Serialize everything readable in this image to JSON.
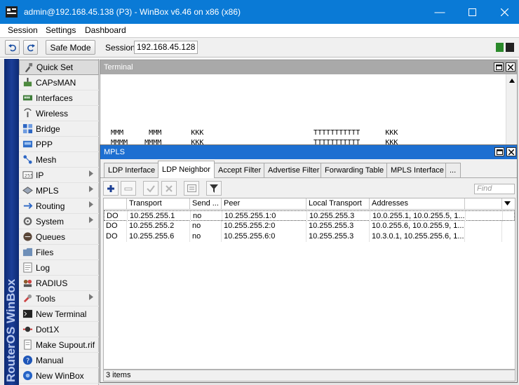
{
  "window": {
    "title": "admin@192.168.45.138 (P3) - WinBox v6.46 on x86 (x86)"
  },
  "menu": [
    "Session",
    "Settings",
    "Dashboard"
  ],
  "toolbar": {
    "safe_mode_label": "Safe Mode",
    "session_label": "Session:",
    "session_value": "192.168.45.128"
  },
  "brand_vertical": "RouterOS WinBox",
  "sidebar": {
    "items": [
      {
        "label": "Quick Set",
        "icon": "quick-set-icon",
        "arrow": false
      },
      {
        "label": "CAPsMAN",
        "icon": "capsman-icon",
        "arrow": false
      },
      {
        "label": "Interfaces",
        "icon": "interfaces-icon",
        "arrow": false
      },
      {
        "label": "Wireless",
        "icon": "wireless-icon",
        "arrow": false
      },
      {
        "label": "Bridge",
        "icon": "bridge-icon",
        "arrow": false
      },
      {
        "label": "PPP",
        "icon": "ppp-icon",
        "arrow": false
      },
      {
        "label": "Mesh",
        "icon": "mesh-icon",
        "arrow": false
      },
      {
        "label": "IP",
        "icon": "ip-icon",
        "arrow": true
      },
      {
        "label": "MPLS",
        "icon": "mpls-icon",
        "arrow": true
      },
      {
        "label": "Routing",
        "icon": "routing-icon",
        "arrow": true
      },
      {
        "label": "System",
        "icon": "system-icon",
        "arrow": true
      },
      {
        "label": "Queues",
        "icon": "queues-icon",
        "arrow": false
      },
      {
        "label": "Files",
        "icon": "files-icon",
        "arrow": false
      },
      {
        "label": "Log",
        "icon": "log-icon",
        "arrow": false
      },
      {
        "label": "RADIUS",
        "icon": "radius-icon",
        "arrow": false
      },
      {
        "label": "Tools",
        "icon": "tools-icon",
        "arrow": true
      },
      {
        "label": "New Terminal",
        "icon": "terminal-icon",
        "arrow": false
      },
      {
        "label": "Dot1X",
        "icon": "dot1x-icon",
        "arrow": false
      },
      {
        "label": "Make Supout.rif",
        "icon": "supout-icon",
        "arrow": false
      },
      {
        "label": "Manual",
        "icon": "manual-icon",
        "arrow": false
      },
      {
        "label": "New WinBox",
        "icon": "winbox-icon",
        "arrow": false
      }
    ]
  },
  "terminal": {
    "title": "Terminal",
    "line1": "MMM      MMM       KKK                          TTTTTTTTTTT      KKK",
    "line2": "MMMM    MMMM       KKK                          TTTTTTTTTTT      KKK"
  },
  "mpls": {
    "title": "MPLS",
    "tabs": [
      "LDP Interface",
      "LDP Neighbor",
      "Accept Filter",
      "Advertise Filter",
      "Forwarding Table",
      "MPLS Interface",
      "..."
    ],
    "active_tab": "LDP Neighbor",
    "find_placeholder": "Find",
    "columns": [
      "",
      "Transport",
      "Send ...",
      "Peer",
      "Local Transport",
      "Addresses"
    ],
    "rows": [
      [
        "DO",
        "10.255.255.1",
        "no",
        "10.255.255.1:0",
        "10.255.255.3",
        "10.0.255.1, 10.0.255.5, 1..."
      ],
      [
        "DO",
        "10.255.255.2",
        "no",
        "10.255.255.2:0",
        "10.255.255.3",
        "10.0.255.6, 10.0.255.9, 1..."
      ],
      [
        "DO",
        "10.255.255.6",
        "no",
        "10.255.255.6:0",
        "10.255.255.3",
        "10.3.0.1, 10.255.255.6, 1..."
      ]
    ],
    "status": "3 items"
  },
  "colors": {
    "titlebar": "#0a7ad6",
    "mpls_title": "#1d6fd1",
    "terminal_title": "#a9a9a9",
    "status_green": "#2b8a2b"
  }
}
